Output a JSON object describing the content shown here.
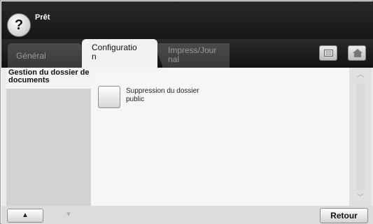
{
  "status": {
    "text": "Prêt",
    "help_icon": "?"
  },
  "tabs": [
    {
      "label": "Général"
    },
    {
      "label": "Configuratio n"
    },
    {
      "label": "Impress/Jour nal"
    }
  ],
  "header_icons": {
    "keyboard": "keyboard-icon",
    "home": "home-icon"
  },
  "left_panel": {
    "title": "Gestion du dossier de documents"
  },
  "settings": [
    {
      "label": "Suppression du dossier public"
    }
  ],
  "navigation": {
    "up_glyph": "▲",
    "down_glyph": "▼",
    "back_label": "Retour"
  },
  "scroll": {
    "up_glyph": "︿",
    "down_glyph": "﹀"
  },
  "colors": {
    "topbar": "#161616",
    "active_tab": "#f1f1f1",
    "panel": "#d2d2d2"
  }
}
